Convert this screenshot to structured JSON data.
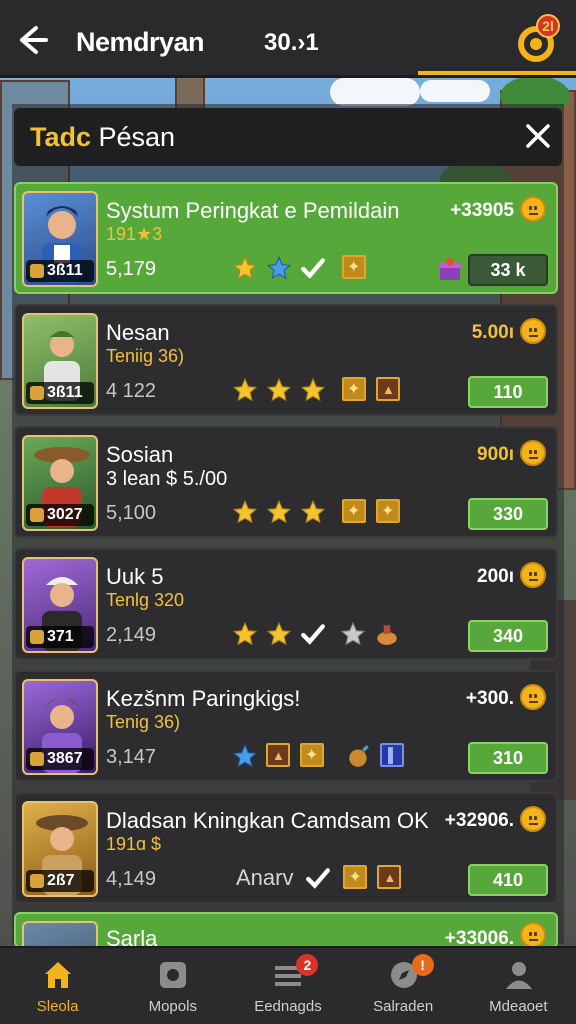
{
  "header": {
    "title": "Nemdryan",
    "score": "30.›1",
    "coin_badge": "2l"
  },
  "panel": {
    "title_accent": "Tadc",
    "title_rest": " Pésan"
  },
  "rows": [
    {
      "name": "Systum Peringkat e Pemildain",
      "sub": "191★3",
      "points": "5,179",
      "level": "3ß11",
      "amount": "+33905",
      "action": "33 k",
      "highlighted": true
    },
    {
      "name": "Nesan",
      "sub": "Teniig 36)",
      "points": "4 122",
      "level": "3ß11",
      "amount": "5.00ı",
      "action": "110"
    },
    {
      "name": "Sosian",
      "sub": "3 lean $ 5./00",
      "points": "5,100",
      "level": "3027",
      "amount": "900ı",
      "action": "330"
    },
    {
      "name": "Uuk 5",
      "sub": "Tenlg 320",
      "points": "2,149",
      "level": "371",
      "amount": "200ı",
      "action": "340"
    },
    {
      "name": "Kezšnm Paringkigs!",
      "sub": "Tenig 36)",
      "points": "3,147",
      "level": "3867",
      "amount": "+300.",
      "action": "310"
    },
    {
      "name": "Dladsan Kningkan Camdsam OK",
      "sub": "191ɑ $",
      "points": "4,149",
      "level": "2ß7",
      "amount": "+32906.",
      "action": "410",
      "extra_word": "Anarv"
    },
    {
      "name": "Sarla",
      "amount": "+33006.",
      "highlighted": true
    }
  ],
  "nav": [
    {
      "label": "Sleola",
      "icon": "home-icon",
      "active": true
    },
    {
      "label": "Mopols",
      "icon": "map-pin-icon"
    },
    {
      "label": "Eednagds",
      "icon": "list-icon",
      "badge": "2"
    },
    {
      "label": "Salraden",
      "icon": "compass-icon",
      "badge": "!"
    },
    {
      "label": "Mdeaoet",
      "icon": "profile-icon"
    }
  ],
  "colors": {
    "accent": "#f2b31b",
    "highlight_row": "#56a83b",
    "panel_bg": "#2d2d2f",
    "badge": "#d8332b"
  }
}
